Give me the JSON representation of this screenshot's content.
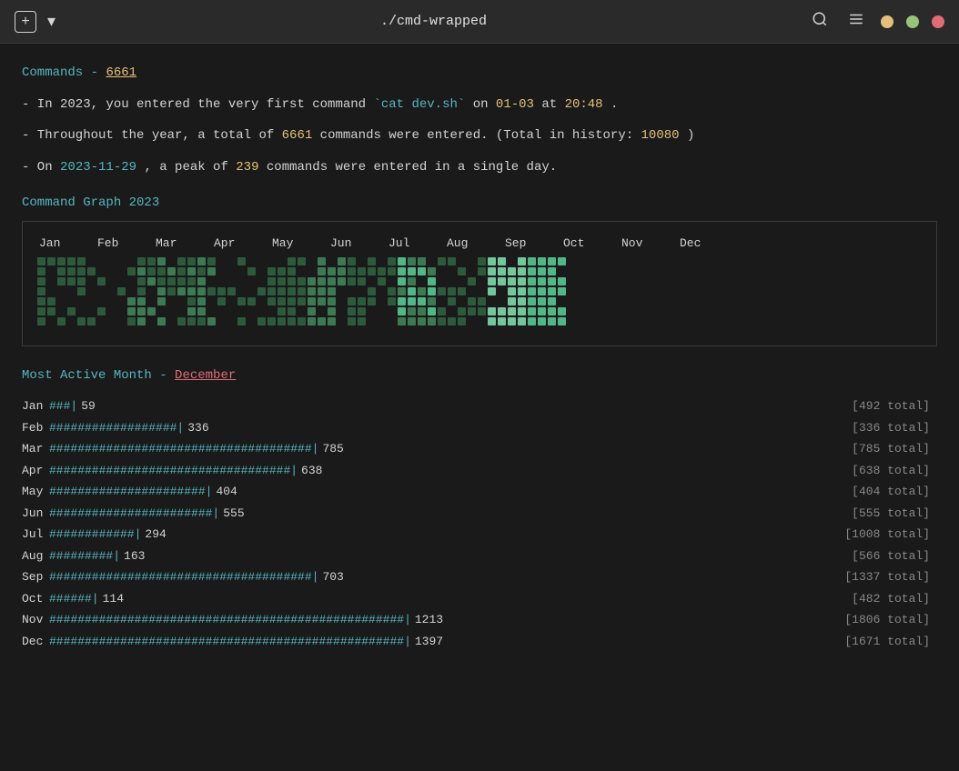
{
  "header": {
    "title": "./cmd-wrapped",
    "plus_label": "+",
    "chevron_label": "▾",
    "search_label": "🔍",
    "menu_label": "☰"
  },
  "commands_section": {
    "label": "Commands",
    "count": "6661",
    "first_command_text": "In 2023, you entered the very first command ",
    "first_command_code": "`cat dev.sh`",
    "first_command_date": "01-03",
    "first_command_time": "20:48",
    "total_text_prefix": "Throughout the year, a total of ",
    "total_commands": "6661",
    "total_history": "10080",
    "peak_date": "2023-11-29",
    "peak_count": "239",
    "graph_title": "Command Graph 2023"
  },
  "most_active": {
    "label": "Most Active Month",
    "month": "December",
    "months": [
      {
        "name": "Jan",
        "bar": "###",
        "count": "59",
        "total": "492"
      },
      {
        "name": "Feb",
        "bar": "##################",
        "count": "336",
        "total": "336"
      },
      {
        "name": "Mar",
        "bar": "#####################################",
        "count": "785",
        "total": "785"
      },
      {
        "name": "Apr",
        "bar": "##################################",
        "count": "638",
        "total": "638"
      },
      {
        "name": "May",
        "bar": "######################",
        "count": "404",
        "total": "404"
      },
      {
        "name": "Jun",
        "bar": "#######################",
        "count": "555",
        "total": "555"
      },
      {
        "name": "Jul",
        "bar": "############",
        "count": "294",
        "total": "1008"
      },
      {
        "name": "Aug",
        "bar": "#########",
        "count": "163",
        "total": "566"
      },
      {
        "name": "Sep",
        "bar": "#####################################",
        "count": "703",
        "total": "1337"
      },
      {
        "name": "Oct",
        "bar": "######",
        "count": "114",
        "total": "482"
      },
      {
        "name": "Nov",
        "bar": "##################################################",
        "count": "1213",
        "total": "1806"
      },
      {
        "name": "Dec",
        "bar": "##################################################",
        "count": "1397",
        "total": "1671"
      }
    ]
  }
}
